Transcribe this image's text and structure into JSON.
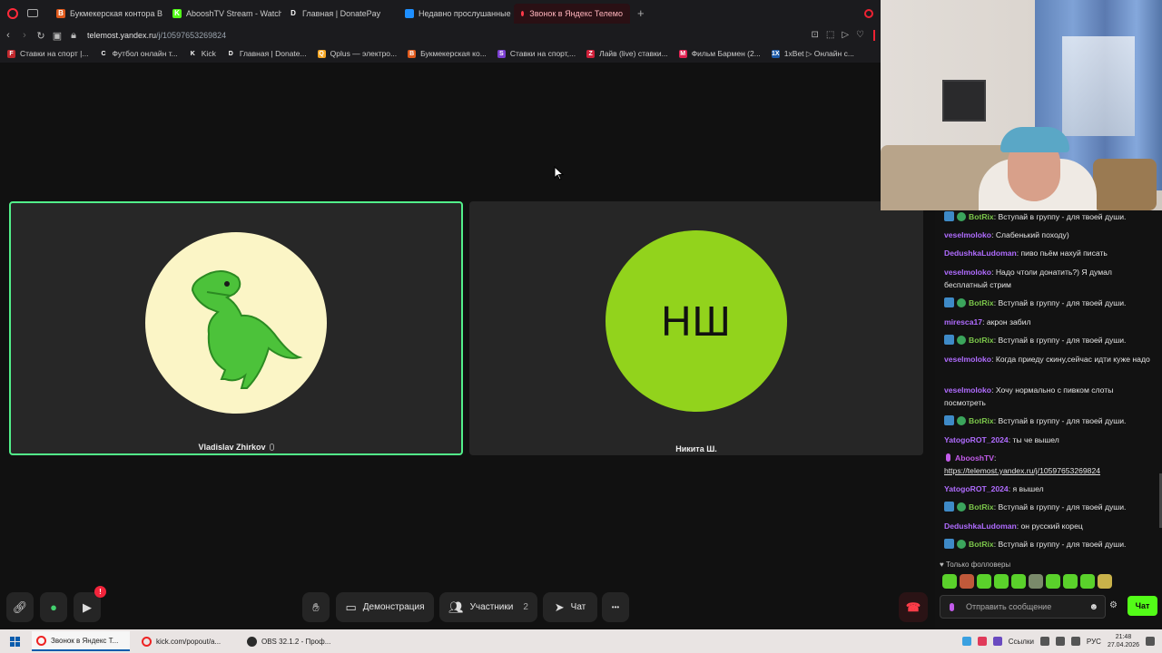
{
  "browser": {
    "tabs": [
      {
        "label": "Букмекерская контора B",
        "fav_color": "#e05a1c",
        "fav": "B"
      },
      {
        "label": "AbooshTV Stream - Watch",
        "fav_color": "#53fc18",
        "fav": "K"
      },
      {
        "label": "Главная | DonatePay",
        "fav_color": "#1b1b1e",
        "fav": "D"
      },
      {
        "label": "Недавно прослушанные",
        "fav_color": "#1e8fff",
        "fav": ""
      },
      {
        "label": "Звонок в Яндекс Телемо",
        "fav_color": "#ff3a4a",
        "fav": "",
        "active": true
      }
    ],
    "new_tab": "+",
    "url_host": "telemost.yandex.ru",
    "url_path": "/j/10597653269824",
    "bookmarks": [
      {
        "label": "Ставки на спорт |...",
        "fav_color": "#c0282d",
        "fav": "F"
      },
      {
        "label": "Футбол онлайн т...",
        "fav_color": "#1b1b1e",
        "fav": "С"
      },
      {
        "label": "Kick",
        "fav_color": "#1b1b1e",
        "fav": "K"
      },
      {
        "label": "Главная | Donate...",
        "fav_color": "#1b1b1e",
        "fav": "D"
      },
      {
        "label": "Qplus — электро...",
        "fav_color": "#f5a623",
        "fav": "Q"
      },
      {
        "label": "Букмекерская ко...",
        "fav_color": "#e05a1c",
        "fav": "B"
      },
      {
        "label": "Ставки на спорт,...",
        "fav_color": "#7b3fd0",
        "fav": "S"
      },
      {
        "label": "Лайв (live) ставки...",
        "fav_color": "#d0203a",
        "fav": "Z"
      },
      {
        "label": "Фильм Бармен (2...",
        "fav_color": "#e02050",
        "fav": "M"
      },
      {
        "label": "1xBet ▷ Онлайн с...",
        "fav_color": "#1c5aa8",
        "fav": "1X"
      }
    ]
  },
  "call": {
    "participants": [
      {
        "name": "Vladislav Zhirkov",
        "avatar_emoji": "🦖",
        "avatar_color": "#fbf5c6",
        "speaking": true
      },
      {
        "name": "Никита Ш.",
        "initials": "НШ",
        "avatar_color": "#92d31c"
      }
    ],
    "controls": {
      "link_icon": "link-icon",
      "mic_icon": "microphone-icon",
      "camera_badge": "!",
      "hand_icon": "raise-hand-icon",
      "screen_share": "Демонстрация",
      "participants": "Участники",
      "participants_count": "2",
      "chat": "Чат",
      "more": "•••",
      "hangup_icon": "hang-up-icon"
    }
  },
  "chat": {
    "messages": [
      {
        "user": "BotRix",
        "user_color": "#7cc84b",
        "text": ": Вступай в группу - для твоей души.",
        "bot": true
      },
      {
        "user": "veselmoloko",
        "user_color": "#b06cff",
        "text": ": Слабенький походу)"
      },
      {
        "user": "DedushkaLudoman",
        "user_color": "#b06cff",
        "text": ": пиво пьём нахуй писать"
      },
      {
        "user": "veselmoloko",
        "user_color": "#b06cff",
        "text": ": Надо чтоли донатить?) Я думал бесплатный стрим"
      },
      {
        "user": "BotRix",
        "user_color": "#7cc84b",
        "text": ": Вступай в группу - для твоей души.",
        "bot": true
      },
      {
        "user": "miresca17",
        "user_color": "#b06cff",
        "text": ": акрон забил"
      },
      {
        "user": "BotRix",
        "user_color": "#7cc84b",
        "text": ": Вступай в группу - для твоей души.",
        "bot": true
      },
      {
        "user": "veselmoloko",
        "user_color": "#b06cff",
        "text": ": Когда приеду скину,сейчас идти куже надо"
      },
      {
        "user": "veselmoloko",
        "user_color": "#b06cff",
        "text": ": Хочу нормально с пивком слоты посмотреть"
      },
      {
        "user": "BotRix",
        "user_color": "#7cc84b",
        "text": ": Вступай в группу - для твоей души.",
        "bot": true
      },
      {
        "user": "YatogoROT_2024",
        "user_color": "#b06cff",
        "text": ": ты че вышел"
      },
      {
        "user": "AbooshTV",
        "user_color": "#c25bea",
        "text": ":",
        "link": "https://telemost.yandex.ru/j/10597653269824",
        "broadcaster": true
      },
      {
        "user": "YatogoROT_2024",
        "user_color": "#b06cff",
        "text": ": я вышел"
      },
      {
        "user": "BotRix",
        "user_color": "#7cc84b",
        "text": ": Вступай в группу - для твоей души.",
        "bot": true
      },
      {
        "user": "DedushkaLudoman",
        "user_color": "#b06cff",
        "text": ": он русский корец"
      },
      {
        "user": "BotRix",
        "user_color": "#7cc84b",
        "text": ": Вступай в группу - для твоей души.",
        "bot": true
      }
    ],
    "followers_only": "Только фолловеры",
    "input_placeholder": "Отправить сообщение",
    "send_label": "Чат"
  },
  "taskbar": {
    "tasks": [
      {
        "label": "Звонок в Яндекс Т...",
        "active": true
      },
      {
        "label": "kick.com/popout/a..."
      },
      {
        "label": "OBS 32.1.2 - Проф..."
      }
    ],
    "links_label": "Ссылки",
    "lang": "РУС",
    "time": "21:48",
    "date": "27.04.2026"
  }
}
